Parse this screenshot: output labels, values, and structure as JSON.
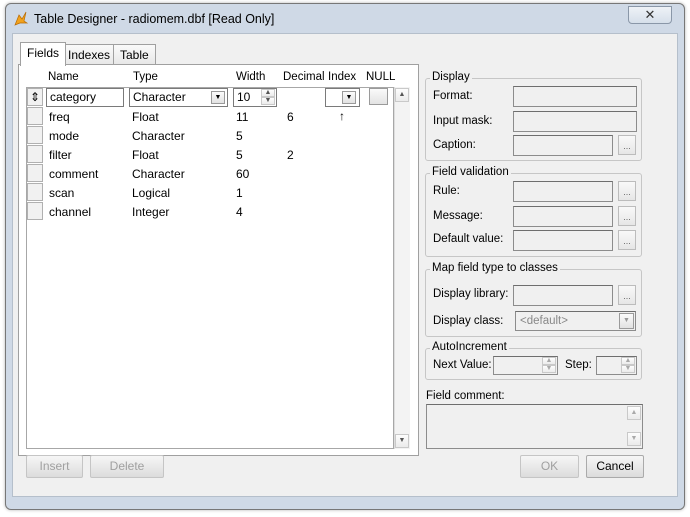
{
  "window": {
    "title": "Table Designer - radiomem.dbf [Read Only]",
    "close_glyph": "✕"
  },
  "tabs": [
    {
      "label": "Fields"
    },
    {
      "label": "Indexes"
    },
    {
      "label": "Table"
    }
  ],
  "columns": {
    "name": "Name",
    "type": "Type",
    "width": "Width",
    "decimal": "Decimal",
    "index": "Index",
    "null": "NULL"
  },
  "fields": [
    {
      "name": "category",
      "type": "Character",
      "width": "10",
      "decimal": "",
      "index": ""
    },
    {
      "name": "freq",
      "type": "Float",
      "width": "11",
      "decimal": "6",
      "index": "↑"
    },
    {
      "name": "mode",
      "type": "Character",
      "width": "5",
      "decimal": "",
      "index": ""
    },
    {
      "name": "filter",
      "type": "Float",
      "width": "5",
      "decimal": "2",
      "index": ""
    },
    {
      "name": "comment",
      "type": "Character",
      "width": "60",
      "decimal": "",
      "index": ""
    },
    {
      "name": "scan",
      "type": "Logical",
      "width": "1",
      "decimal": "",
      "index": ""
    },
    {
      "name": "channel",
      "type": "Integer",
      "width": "4",
      "decimal": "",
      "index": ""
    }
  ],
  "row_mover_glyph": "⇕",
  "display": {
    "title": "Display",
    "format": "Format:",
    "input_mask": "Input mask:",
    "caption": "Caption:"
  },
  "validation": {
    "title": "Field validation",
    "rule": "Rule:",
    "message": "Message:",
    "default_value": "Default value:"
  },
  "mapping": {
    "title": "Map field type to classes",
    "library": "Display library:",
    "class": "Display class:",
    "class_value": "<default>"
  },
  "autoinc": {
    "title": "AutoIncrement",
    "next_value": "Next Value:",
    "step": "Step:"
  },
  "comment": {
    "title": "Field comment:"
  },
  "buttons": {
    "insert": "Insert",
    "delete": "Delete",
    "ok": "OK",
    "cancel": "Cancel"
  },
  "ellipsis": "..."
}
